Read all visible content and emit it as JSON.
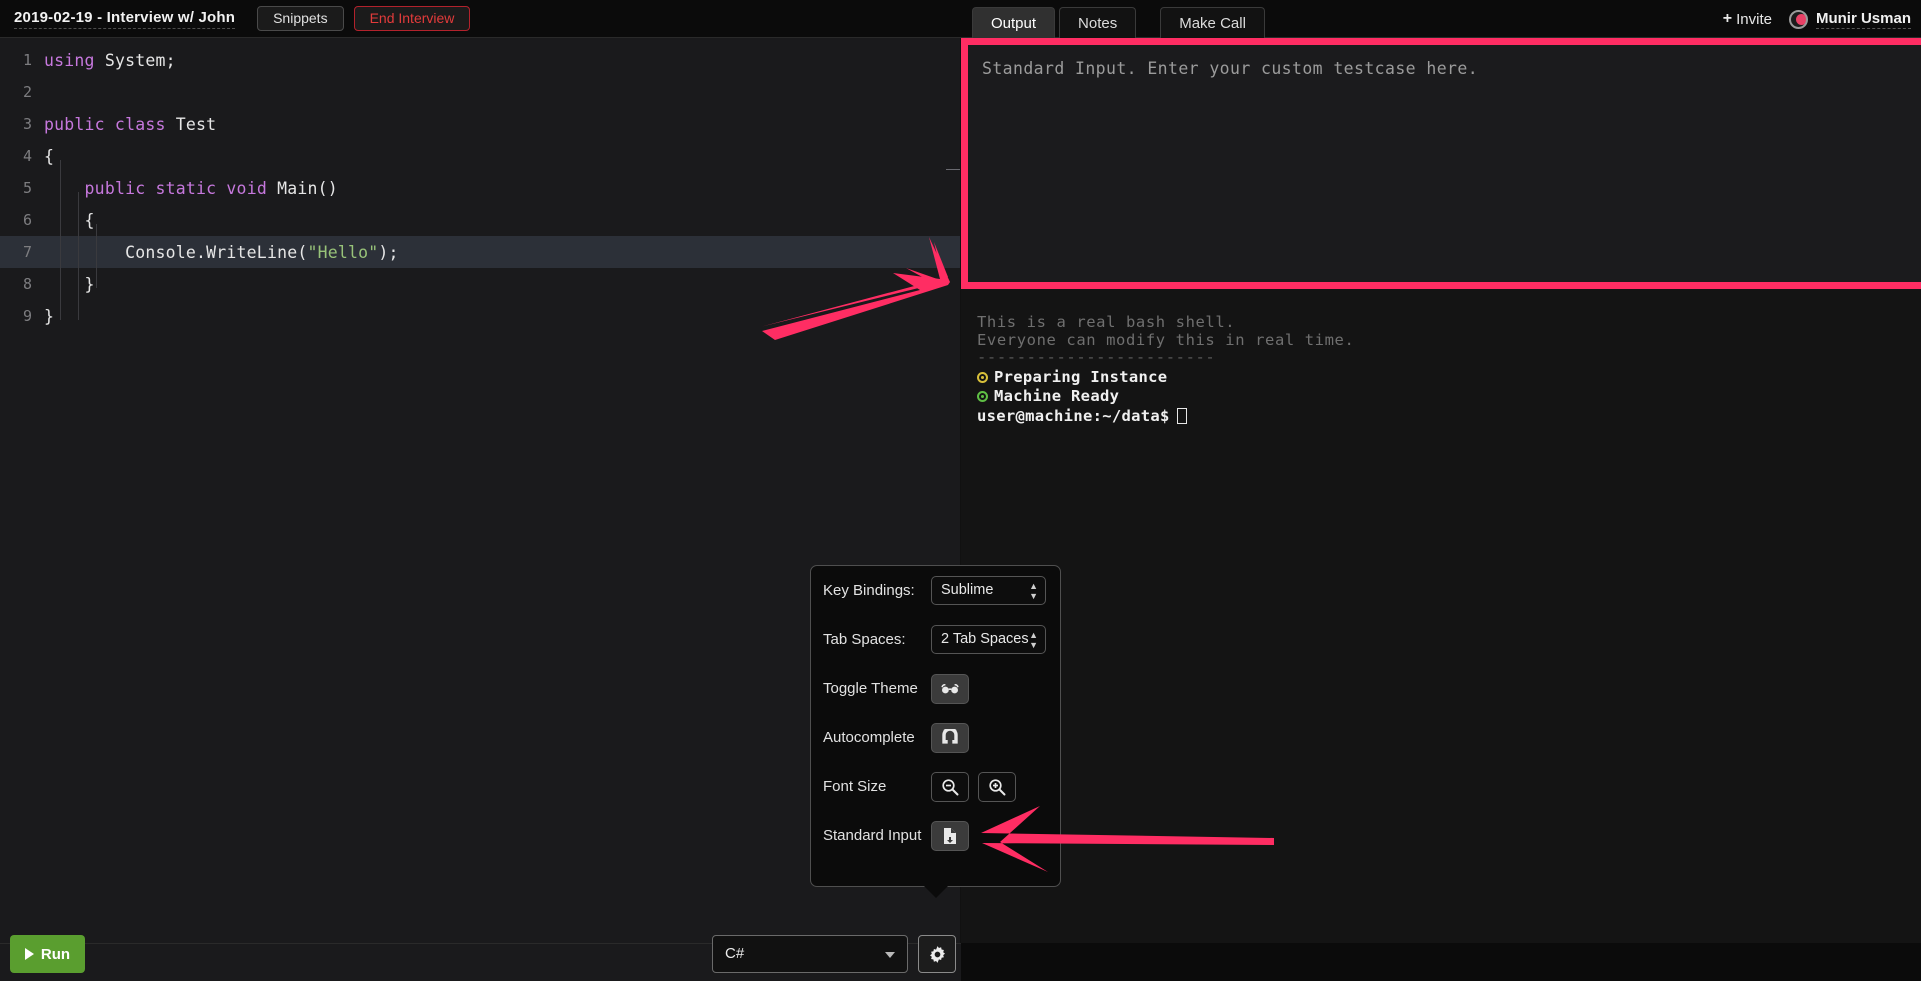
{
  "topbar": {
    "session_title": "2019-02-19 - Interview w/ John",
    "snippets_label": "Snippets",
    "end_interview_label": "End Interview",
    "invite_label": "Invite",
    "invite_plus": "+",
    "username": "Munir Usman",
    "user_dot_color": "#e8335b"
  },
  "tabs": [
    {
      "label": "Output",
      "active": true
    },
    {
      "label": "Notes",
      "active": false
    },
    {
      "label": "Make Call",
      "active": false
    }
  ],
  "editor": {
    "language": "C#",
    "highlighted_line": 7,
    "lines": [
      {
        "num": "1",
        "segments": [
          {
            "t": "using ",
            "c": "kw"
          },
          {
            "t": "System;",
            "c": "pl"
          }
        ]
      },
      {
        "num": "2",
        "segments": []
      },
      {
        "num": "3",
        "segments": [
          {
            "t": "public class ",
            "c": "kw"
          },
          {
            "t": "Test",
            "c": "pl"
          }
        ]
      },
      {
        "num": "4",
        "segments": [
          {
            "t": "{",
            "c": "pl"
          }
        ]
      },
      {
        "num": "5",
        "segments": [
          {
            "t": "    ",
            "c": "pl"
          },
          {
            "t": "public static void ",
            "c": "kw"
          },
          {
            "t": "Main()",
            "c": "pl"
          }
        ]
      },
      {
        "num": "6",
        "segments": [
          {
            "t": "    {",
            "c": "pl"
          }
        ]
      },
      {
        "num": "7",
        "segments": [
          {
            "t": "        Console.WriteLine(",
            "c": "pl"
          },
          {
            "t": "\"Hello\"",
            "c": "str"
          },
          {
            "t": ");",
            "c": "pl"
          }
        ]
      },
      {
        "num": "8",
        "segments": [
          {
            "t": "    }",
            "c": "pl"
          }
        ]
      },
      {
        "num": "9",
        "segments": [
          {
            "t": "}",
            "c": "pl"
          }
        ]
      }
    ]
  },
  "stdin": {
    "placeholder": "Standard Input. Enter your custom testcase here.",
    "value": "",
    "highlight_color": "#ff2d63"
  },
  "terminal": {
    "intro_line_1": "This is a real bash shell.",
    "intro_line_2": "Everyone can modify this in real time.",
    "separator": "------------------------",
    "status": [
      {
        "label": "Preparing Instance",
        "color": "#d8c03a"
      },
      {
        "label": "Machine Ready",
        "color": "#5fbf45"
      }
    ],
    "prompt": "user@machine:~/data$"
  },
  "settings": {
    "rows": [
      {
        "label": "Key Bindings:",
        "type": "select",
        "value": "Sublime"
      },
      {
        "label": "Tab Spaces:",
        "type": "select",
        "value": "2 Tab Spaces"
      },
      {
        "label": "Toggle Theme",
        "type": "button",
        "icon": "glasses-icon"
      },
      {
        "label": "Autocomplete",
        "type": "button",
        "icon": "magnet-icon"
      },
      {
        "label": "Font Size",
        "type": "button-pair",
        "icon": "zoom-out-icon",
        "icon2": "zoom-in-icon"
      },
      {
        "label": "Standard Input",
        "type": "button",
        "icon": "file-upload-icon"
      }
    ]
  },
  "bottombar": {
    "run_label": "Run",
    "language_value": "C#",
    "settings_icon": "gear-icon"
  },
  "annotations": {
    "arrow_color": "#ff2d63",
    "arrow_to_stdin": "points up-right to the Standard Input textarea",
    "arrow_to_button": "points left to the Standard Input toggle button"
  }
}
